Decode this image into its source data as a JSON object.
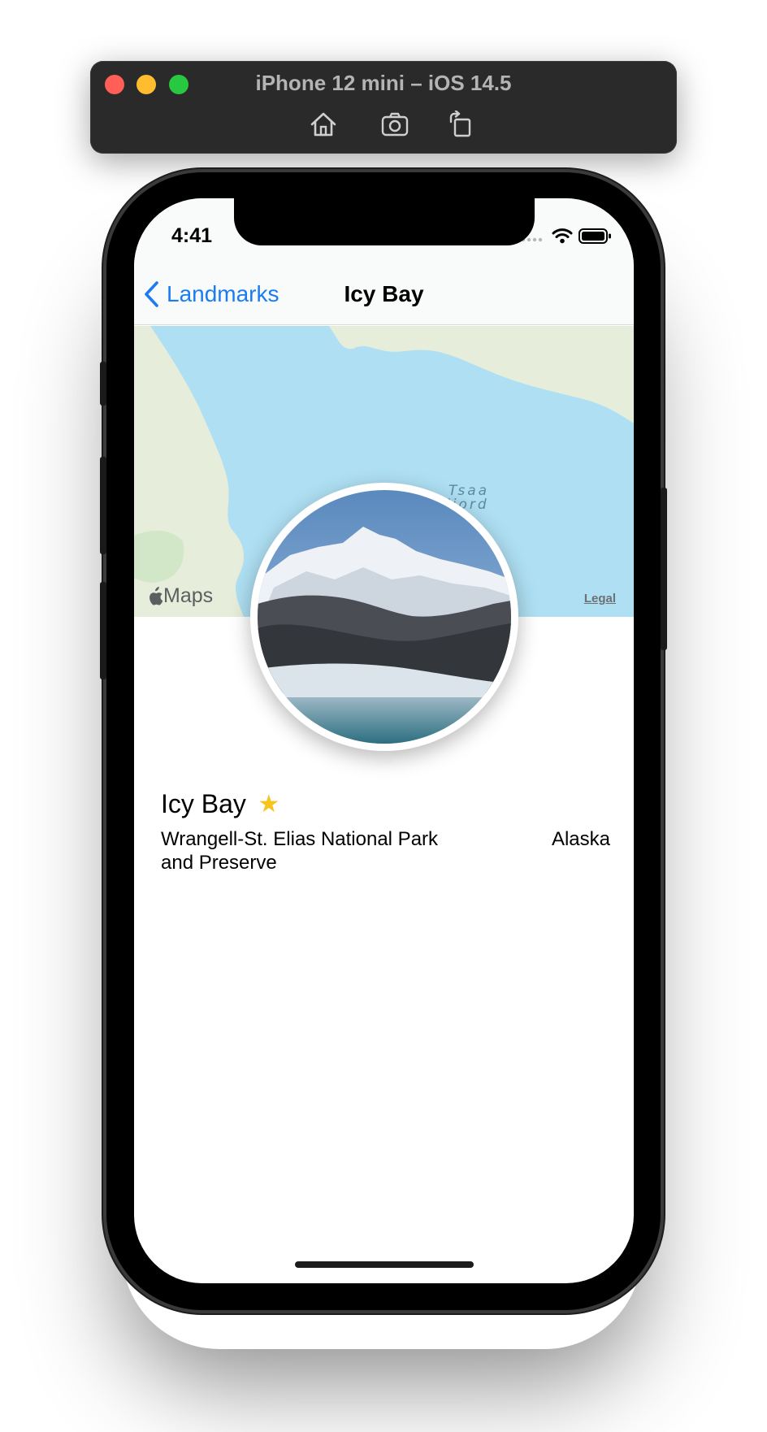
{
  "simulator": {
    "title": "iPhone 12 mini – iOS 14.5",
    "toolbar_icons": [
      "home-icon",
      "screenshot-icon",
      "rotate-icon"
    ]
  },
  "status_bar": {
    "time": "4:41"
  },
  "nav": {
    "back_label": "Landmarks",
    "title": "Icy Bay"
  },
  "map": {
    "place_label_line1": "Tsaa",
    "place_label_line2": "Fiord",
    "logo_text": "Maps",
    "legal_label": "Legal"
  },
  "landmark": {
    "name": "Icy Bay",
    "is_favorite": true,
    "park_line1": "Wrangell-St. Elias National Park",
    "park_line2": "and Preserve",
    "state": "Alaska"
  },
  "colors": {
    "accent": "#1b7cf2",
    "favorite_star": "#f7c41b",
    "water": "#aedff2",
    "land": "#e6eedb"
  }
}
